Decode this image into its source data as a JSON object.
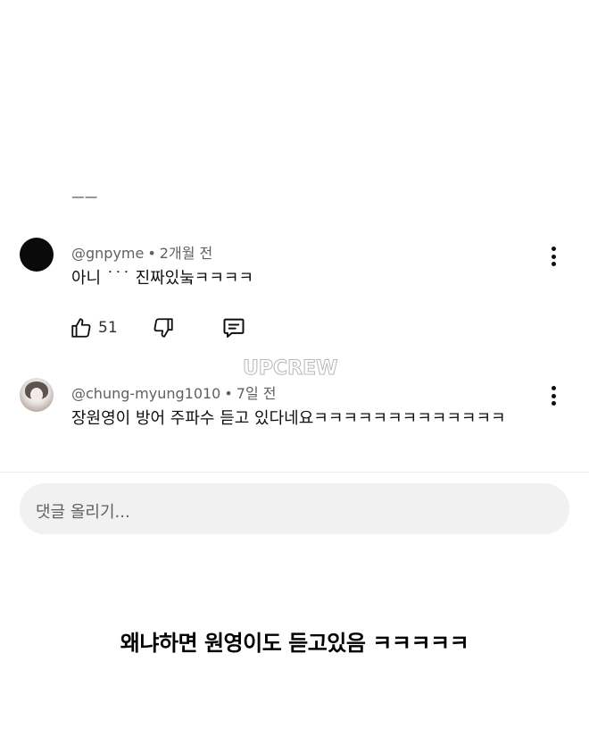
{
  "cut_text": "ㅡㅡ  ..",
  "comments": [
    {
      "handle": "@gnpyme",
      "time": "2개월 전",
      "text": "아니 ˙˙˙ 진짜있눜ㅋㅋㅋㅋ",
      "likes": "51",
      "avatar": "black-avatar"
    },
    {
      "handle": "@chung-myung1010",
      "time": "7일 전",
      "text": "장원영이 방어 주파수 듣고 있다네요ㅋㅋㅋㅋㅋㅋㅋㅋㅋㅋㅋㅋㅋ",
      "avatar": "photo-avatar"
    }
  ],
  "separator": "•",
  "watermark": "UPCREW",
  "reply": {
    "placeholder": "댓글 올리기..."
  },
  "caption": "왜냐하면 원영이도 듣고있음 ㅋㅋㅋㅋㅋ",
  "icons": {
    "like": "thumbs-up-icon",
    "dislike": "thumbs-down-icon",
    "reply": "comment-icon",
    "menu": "more-vert-icon"
  },
  "colors": {
    "text_primary": "#0f0f0f",
    "text_secondary": "#606060",
    "input_background": "#f1f1f1"
  }
}
